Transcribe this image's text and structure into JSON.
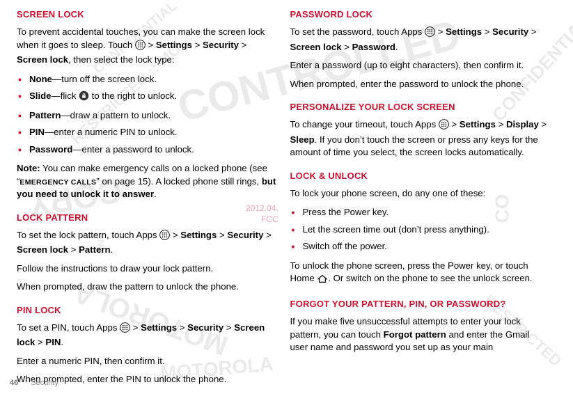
{
  "left": {
    "h1": "SCREEN LOCK",
    "intro_a": "To prevent accidental touches, you can make the screen lock when it goes to sleep. Touch ",
    "intro_b": " > ",
    "settings": "Settings",
    "intro_c": " > ",
    "security": "Security",
    "intro_d": " > ",
    "screenlock": "Screen lock",
    "intro_e": ", then select the lock type:",
    "items": [
      {
        "term": "None",
        "desc": "—turn off the screen lock."
      },
      {
        "term": "Slide",
        "desc_a": "—flick ",
        "desc_b": " to the right to unlock."
      },
      {
        "term": "Pattern",
        "desc": "—draw a pattern to unlock."
      },
      {
        "term": "PIN",
        "desc": "—enter a numeric PIN to unlock."
      },
      {
        "term": "Password",
        "desc": "—enter a password to unlock."
      }
    ],
    "note_label": "Note:",
    "note_a": " You can make emergency calls on a locked phone (see “",
    "note_link": "EMERGENCY CALLS",
    "note_b": "” on page 15). A locked phone still rings, ",
    "note_c": "but you need to unlock it to answer",
    "note_d": ".",
    "h2": "LOCK PATTERN",
    "lp_a": "To set the lock pattern, touch Apps ",
    "lp_b": " > ",
    "lp_c": " > ",
    "lp_d": " > ",
    "pattern": "Pattern",
    "lp_e": ".",
    "lp_follow": "Follow the instructions to draw your lock pattern.",
    "lp_prompt": "When prompted, draw the pattern to unlock the phone.",
    "h3": "PIN LOCK",
    "pin_a": "To set a PIN, touch Apps ",
    "pin_b": " > ",
    "pin_c": " > ",
    "pin_d": " > ",
    "pin": "PIN",
    "pin_e": ".",
    "pin_enter": "Enter a numeric PIN, then confirm it.",
    "pin_prompt": "When prompted, enter the PIN to unlock the phone."
  },
  "right": {
    "h1": "PASSWORD LOCK",
    "pw_a": "To set the password, touch Apps ",
    "pw_b": " > ",
    "pw_c": " > ",
    "pw_d": " > ",
    "password": "Password",
    "pw_e": ".",
    "pw_enter": "Enter a password (up to eight characters), then confirm it.",
    "pw_prompt": "When prompted, enter the password to unlock the phone.",
    "h2": "PERSONALIZE YOUR LOCK SCREEN",
    "pl_a": "To change your timeout, touch Apps ",
    "pl_b": " > ",
    "display": "Display",
    "pl_c": " > ",
    "sleep": "Sleep",
    "pl_d": ". If you don’t touch the screen or press any keys for the amount of time you select, the screen locks automatically.",
    "h3": "LOCK & UNLOCK",
    "lu_a": "To lock your phone screen, do any one of these:",
    "lu_items": [
      "Press the Power key.",
      "Let the screen time out (don’t press anything).",
      "Switch off the power."
    ],
    "lu_unlock_a": "To unlock the phone screen, press the Power key, or touch Home ",
    "lu_unlock_b": ". Or switch on the phone to see the unlock screen.",
    "h4": "FORGOT YOUR PATTERN, PIN, OR PASSWORD?",
    "fp_a": "If you make five unsuccessful attempts to enter your lock pattern, you can touch ",
    "forgot": "Forgot pattern",
    "fp_b": " and enter the Gmail user name and password you set up as your main"
  },
  "footer": {
    "page": "46",
    "section": "Security"
  },
  "timestamp": {
    "line1": "2012.04.",
    "line2": "FCC"
  },
  "settings_word": "Settings",
  "security_word": "Security",
  "screenlock_word": "Screen lock"
}
